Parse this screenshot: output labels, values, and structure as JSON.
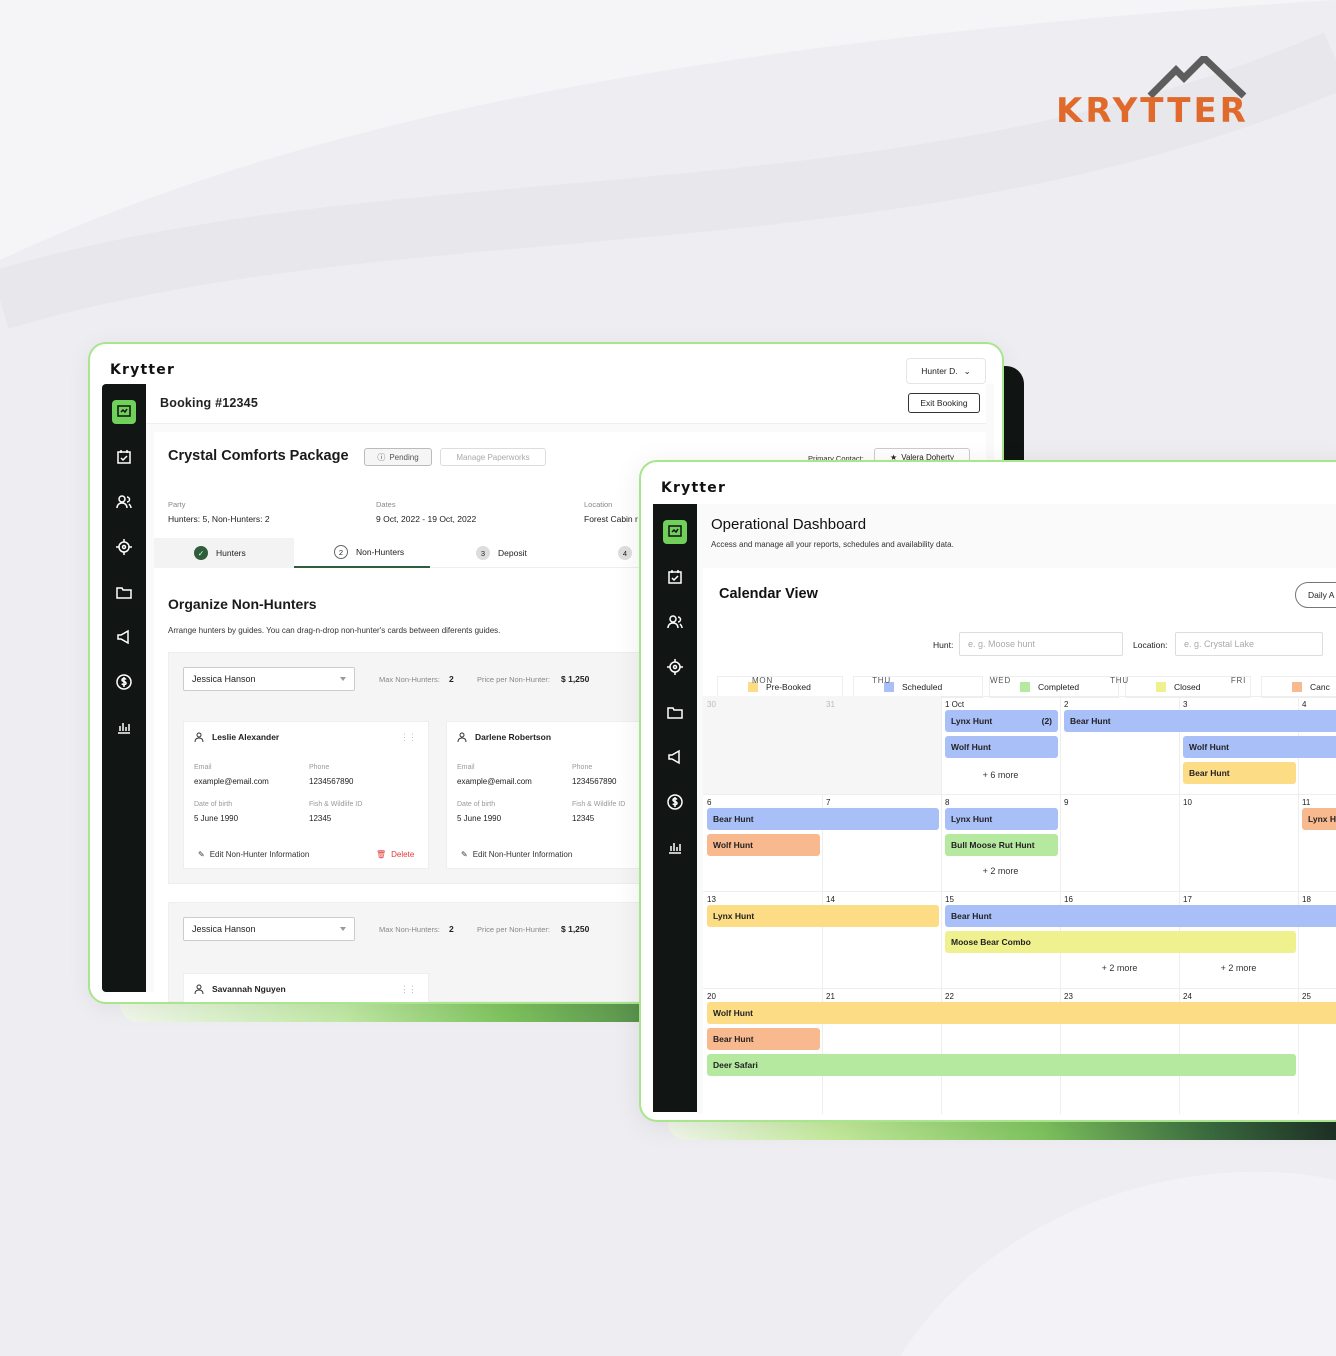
{
  "brand": {
    "logo_text": "KRYTTER",
    "colors": {
      "accent": "#6fd15a",
      "sidebar": "#111513",
      "logo": "#e06a2c"
    }
  },
  "booking_window": {
    "app_name": "Krytter",
    "user_menu": "Hunter D.",
    "page_title": "Booking #12345",
    "exit_button": "Exit Booking",
    "package_title": "Crystal Comforts Package",
    "status_pill": "Pending",
    "manage_button": "Manage Paperworks",
    "primary_contact_label": "Primary Contact:",
    "primary_contact": "Valera Doherty",
    "meta": {
      "party_label": "Party",
      "party_value": "Hunters: 5, Non-Hunters: 2",
      "dates_label": "Dates",
      "dates_value": "9 Oct, 2022 - 19 Oct, 2022",
      "location_label": "Location",
      "location_value": "Forest Cabin r"
    },
    "steps": [
      {
        "num": "",
        "label": "Hunters"
      },
      {
        "num": "2",
        "label": "Non-Hunters"
      },
      {
        "num": "3",
        "label": "Deposit"
      },
      {
        "num": "4",
        "label": "I"
      }
    ],
    "section_title": "Organize Non-Hunters",
    "section_sub": "Arrange hunters by guides. You can drag-n-drop non-hunter's cards between diferents guides.",
    "groups": [
      {
        "guide": "Jessica Hanson",
        "max_label": "Max Non-Hunters:",
        "max_value": "2",
        "price_label": "Price per Non-Hunter:",
        "price_value": "$ 1,250"
      },
      {
        "guide": "Jessica Hanson",
        "max_label": "Max Non-Hunters:",
        "max_value": "2",
        "price_label": "Price per Non-Hunter:",
        "price_value": "$ 1,250"
      }
    ],
    "cards": [
      {
        "name": "Leslie Alexander",
        "email_label": "Email",
        "email": "example@email.com",
        "phone_label": "Phone",
        "phone": "1234567890",
        "dob_label": "Date of birth",
        "dob": "5 June 1990",
        "fw_label": "Fish & Wildlife ID",
        "fw": "12345",
        "edit": "Edit Non-Hunter Information",
        "delete": "Delete"
      },
      {
        "name": "Darlene Robertson",
        "email_label": "Email",
        "email": "example@email.com",
        "phone_label": "Phone",
        "phone": "1234567890",
        "dob_label": "Date of birth",
        "dob": "5 June 1990",
        "fw_label": "Fish & Wildlife ID",
        "fw": "12345",
        "edit": "Edit Non-Hunter Information"
      },
      {
        "name": "Savannah Nguyen"
      }
    ]
  },
  "dashboard_window": {
    "app_name": "Krytter",
    "title": "Operational Dashboard",
    "subtitle": "Access and manage all your reports, schedules and availability data.",
    "calendar_title": "Calendar View",
    "view_button": "Daily A",
    "hunt_label": "Hunt:",
    "hunt_placeholder": "e. g. Moose hunt",
    "location_label": "Location:",
    "location_placeholder": "e. g. Crystal Lake",
    "legend": [
      {
        "label": "Pre-Booked",
        "color": "#fddc86"
      },
      {
        "label": "Scheduled",
        "color": "#a8bff8"
      },
      {
        "label": "Completed",
        "color": "#b5e9a0"
      },
      {
        "label": "Closed",
        "color": "#eff08e"
      },
      {
        "label": "Canc",
        "color": "#f9b98f"
      }
    ],
    "weekdays": [
      "MON",
      "THU",
      "WED",
      "THU",
      "FRI"
    ],
    "days": [
      [
        "30",
        "31",
        "1 Oct",
        "2",
        "3",
        "4"
      ],
      [
        "6",
        "7",
        "8",
        "9",
        "10",
        "11"
      ],
      [
        "13",
        "14",
        "15",
        "16",
        "17",
        "18"
      ],
      [
        "20",
        "21",
        "22",
        "23",
        "24",
        "25"
      ]
    ],
    "events": {
      "w1": [
        {
          "label": "Lynx Hunt",
          "badge": "(2)"
        },
        {
          "label": "Bear Hunt"
        },
        {
          "label": "Wolf Hunt"
        },
        {
          "label": "Wolf Hunt"
        },
        {
          "label": "Bear Hunt"
        }
      ],
      "w1_more": "+ 6 more",
      "w2": [
        {
          "label": "Bear Hunt"
        },
        {
          "label": "Lynx Hunt"
        },
        {
          "label": "Lynx H"
        },
        {
          "label": "Wolf Hunt"
        },
        {
          "label": "Bull Moose Rut Hunt"
        }
      ],
      "w2_more": "+ 2 more",
      "w3": [
        {
          "label": "Lynx Hunt"
        },
        {
          "label": "Bear Hunt"
        },
        {
          "label": "Moose Bear Combo"
        }
      ],
      "w3_more_a": "+ 2 more",
      "w3_more_b": "+ 2 more",
      "w4": [
        {
          "label": "Wolf Hunt"
        },
        {
          "label": "Bear Hunt"
        },
        {
          "label": "Deer Safari"
        }
      ]
    }
  }
}
